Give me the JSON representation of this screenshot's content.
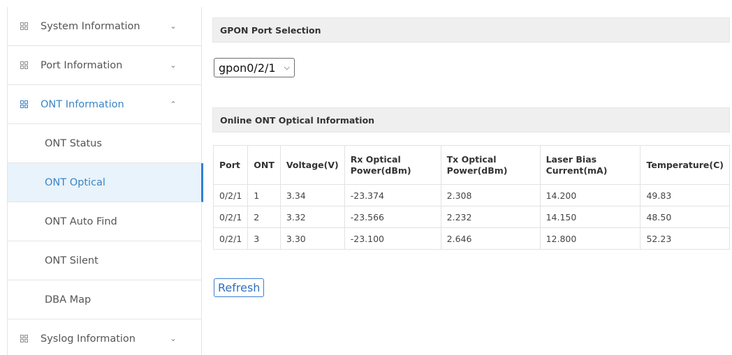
{
  "sidebar": {
    "items": [
      {
        "label": "System Information",
        "icon": "grid-icon",
        "chevron": "chevron-down-icon"
      },
      {
        "label": "Port Information",
        "icon": "grid-icon",
        "chevron": "chevron-down-icon"
      },
      {
        "label": "ONT Information",
        "icon": "grid-icon",
        "chevron": "chevron-up-icon",
        "expanded": true
      },
      {
        "label": "Syslog Information",
        "icon": "grid-icon",
        "chevron": "chevron-down-icon"
      }
    ],
    "sub_items": [
      {
        "label": "ONT Status"
      },
      {
        "label": "ONT Optical",
        "active": true
      },
      {
        "label": "ONT Auto Find"
      },
      {
        "label": "ONT Silent"
      },
      {
        "label": "DBA Map"
      }
    ]
  },
  "gpon_section": {
    "title": "GPON Port Selection",
    "selected_port": "gpon0/2/1"
  },
  "optical_section": {
    "title": "Online ONT Optical Information",
    "columns": [
      "Port",
      "ONT",
      "Voltage(V)",
      "Rx Optical Power(dBm)",
      "Tx Optical Power(dBm)",
      "Laser Bias Current(mA)",
      "Temperature(C)"
    ],
    "rows": [
      [
        "0/2/1",
        "1",
        "3.34",
        "-23.374",
        "2.308",
        "14.200",
        "49.83"
      ],
      [
        "0/2/1",
        "2",
        "3.32",
        "-23.566",
        "2.232",
        "14.150",
        "48.50"
      ],
      [
        "0/2/1",
        "3",
        "3.30",
        "-23.100",
        "2.646",
        "12.800",
        "52.23"
      ]
    ]
  },
  "actions": {
    "refresh_label": "Refresh"
  },
  "colors": {
    "accent": "#3b84c5",
    "active_bg": "#e8f3fb",
    "header_bg": "#efefef"
  }
}
